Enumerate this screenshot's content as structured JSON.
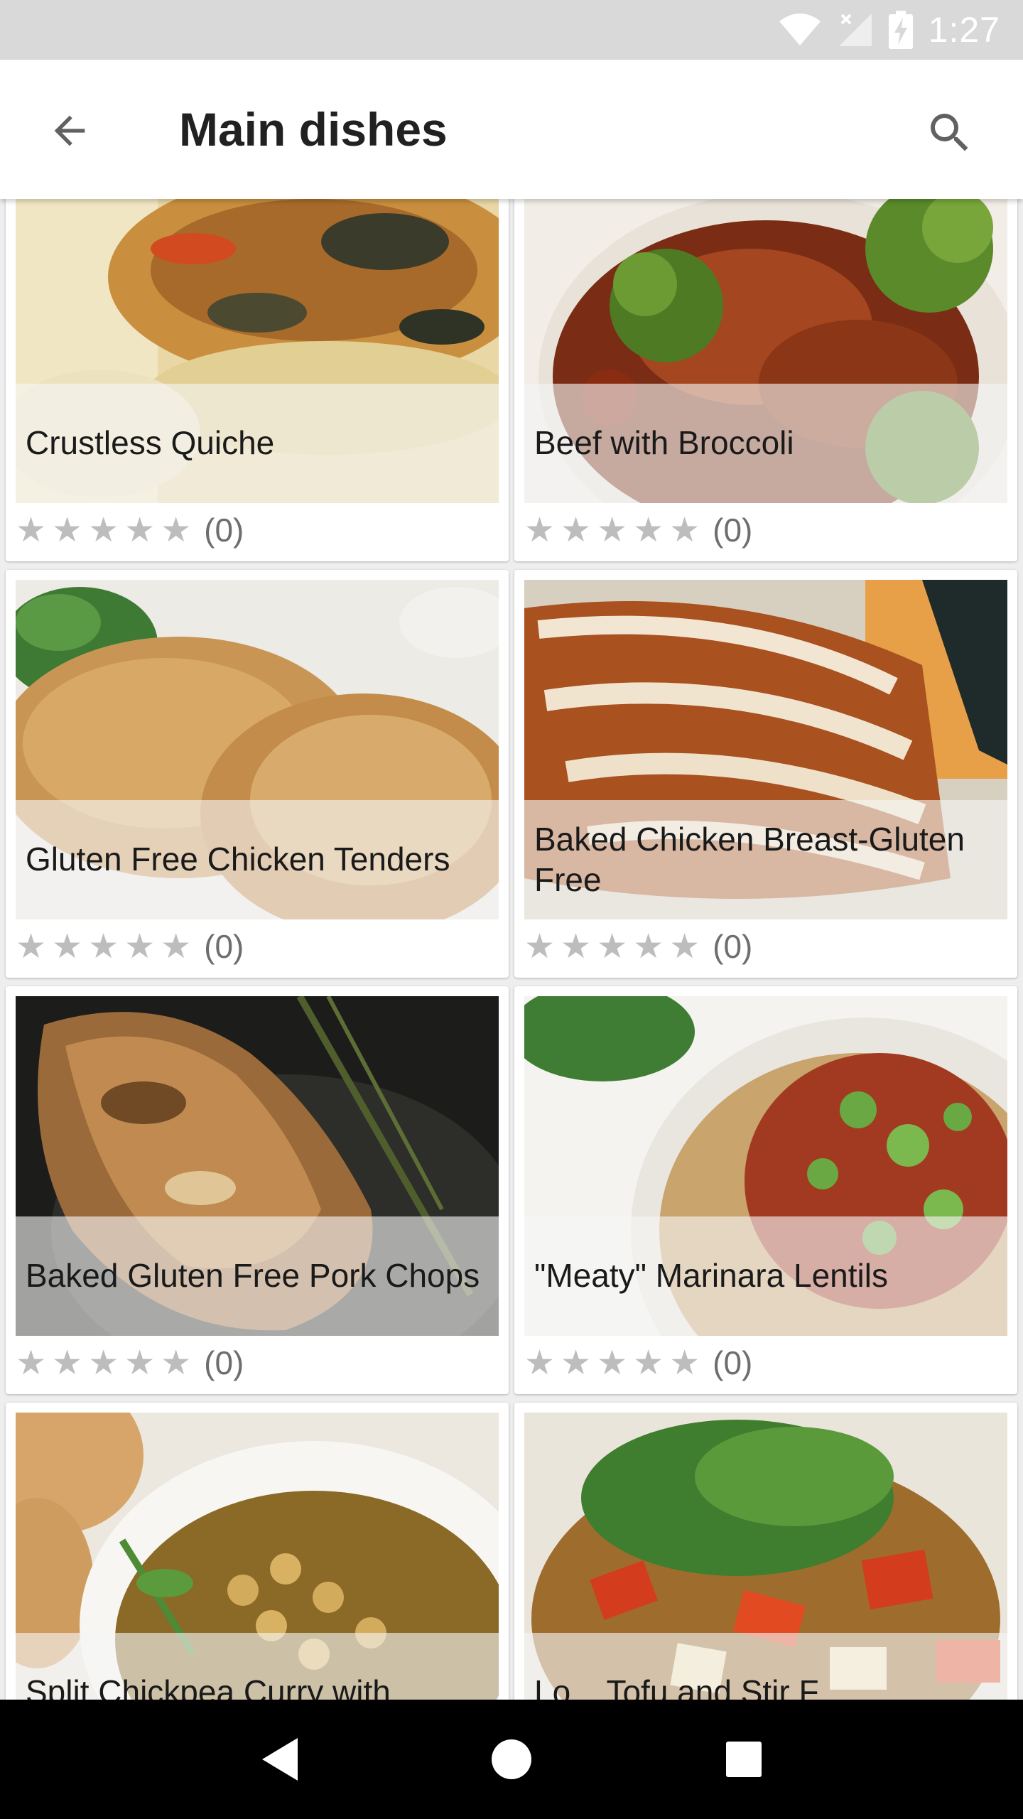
{
  "status_bar": {
    "time": "1:27",
    "icons": [
      "wifi-icon",
      "signal-icon",
      "battery-charging-icon"
    ]
  },
  "app_bar": {
    "title": "Main dishes",
    "back_icon": "arrow-back-icon",
    "search_icon": "search-icon"
  },
  "recipes": [
    {
      "title": "Crustless Quiche",
      "rating_count": "(0)",
      "stars": 5,
      "filled_stars": 0
    },
    {
      "title": "Beef with Broccoli",
      "rating_count": "(0)",
      "stars": 5,
      "filled_stars": 0
    },
    {
      "title": "Gluten Free Chicken Tenders",
      "rating_count": "(0)",
      "stars": 5,
      "filled_stars": 0
    },
    {
      "title": "Baked Chicken Breast-Gluten Free",
      "rating_count": "(0)",
      "stars": 5,
      "filled_stars": 0
    },
    {
      "title": "Baked Gluten Free Pork Chops",
      "rating_count": "(0)",
      "stars": 5,
      "filled_stars": 0
    },
    {
      "title": "\"Meaty\" Marinara Lentils",
      "rating_count": "(0)",
      "stars": 5,
      "filled_stars": 0
    },
    {
      "title": "Split Chickpea Curry with",
      "rating_count": "",
      "stars": 0,
      "filled_stars": 0
    },
    {
      "title": "Lo... Tofu and Stir F...",
      "rating_count": "",
      "stars": 0,
      "filled_stars": 0
    }
  ],
  "nav_bar": {
    "back_icon": "nav-back-icon",
    "home_icon": "nav-home-icon",
    "recents_icon": "nav-recents-icon"
  },
  "colors": {
    "status_bar": "#d9d9d9",
    "app_bar": "#ffffff",
    "background": "#eeeeee",
    "star_empty": "#bdbdbd",
    "nav_bar": "#000000"
  }
}
